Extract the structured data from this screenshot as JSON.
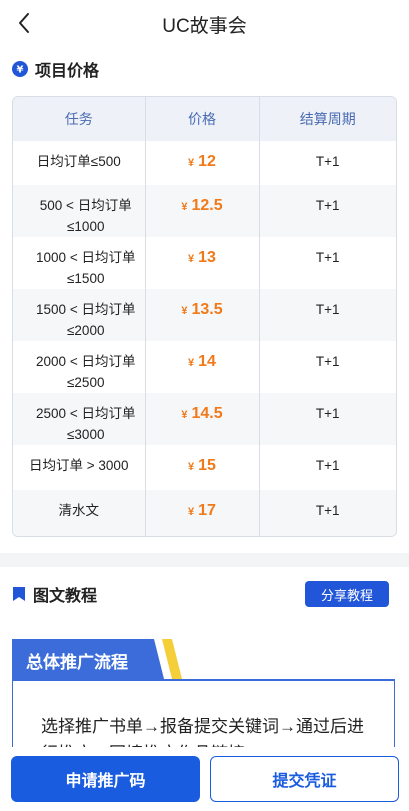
{
  "nav": {
    "title": "UC故事会",
    "back_icon": "chevron-left-icon"
  },
  "price_section": {
    "icon": "yen-circle-icon",
    "title": "项目价格",
    "headers": [
      "任务",
      "价格",
      "结算周期"
    ],
    "currency": "¥",
    "rows": [
      {
        "task": "日均订单≤500",
        "price": "12",
        "period": "T+1"
      },
      {
        "task": "500 < 日均订单≤1000",
        "price": "12.5",
        "period": "T+1"
      },
      {
        "task": "1000 < 日均订单≤1500",
        "price": "13",
        "period": "T+1"
      },
      {
        "task": "1500 < 日均订单≤2000",
        "price": "13.5",
        "period": "T+1"
      },
      {
        "task": "2000 < 日均订单≤2500",
        "price": "14",
        "period": "T+1"
      },
      {
        "task": "2500 < 日均订单≤3000",
        "price": "14.5",
        "period": "T+1"
      },
      {
        "task": "日均订单 > 3000",
        "price": "15",
        "period": "T+1"
      },
      {
        "task": "清水文",
        "price": "17",
        "period": "T+1"
      }
    ]
  },
  "tutorial_section": {
    "icon": "bookmark-icon",
    "title": "图文教程",
    "share_label": "分享教程",
    "flow_title": "总体推广流程",
    "flow_text": "选择推广书单→报备提交关键词→通过后进行推广→回填推广作品链接"
  },
  "bottom_bar": {
    "apply_label": "申请推广码",
    "submit_label": "提交凭证"
  },
  "colors": {
    "primary": "#1a5ce0",
    "price": "#f07a1a",
    "header_text": "#4a6bb3"
  }
}
